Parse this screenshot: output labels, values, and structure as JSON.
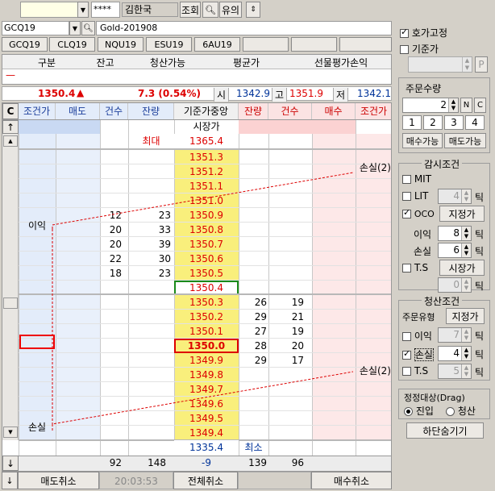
{
  "toolbar": {
    "account_input": "",
    "password_mask": "****",
    "user_name": "김한국",
    "query_button": "조회",
    "help_button": "유의",
    "updown_icon": "◆"
  },
  "symbol": {
    "code": "GCQ19",
    "name": "Gold-201908"
  },
  "tabs": [
    "GCQ19",
    "CLQ19",
    "NQU19",
    "ESU19",
    "6AU19",
    "",
    "",
    ""
  ],
  "position_table": {
    "headers": [
      "구분",
      "잔고",
      "청산가능",
      "평균가",
      "선물평가손익"
    ],
    "row_marker": "—"
  },
  "quote": {
    "price": "1350.4",
    "arrow": "▲",
    "change": "7.3 (0.54%)",
    "open_label": "시",
    "open": "1342.9",
    "high_label": "고",
    "high": "1351.9",
    "low_label": "저",
    "low": "1342.1"
  },
  "grid": {
    "c_button": "C",
    "up_button": "↑",
    "down_button": "↓",
    "headers": [
      "조건가",
      "매도",
      "건수",
      "잔량",
      "기준가중앙",
      "잔량",
      "건수",
      "매수",
      "조건가"
    ],
    "center_top": "시장가",
    "max_label": "최대",
    "max_price": "1365.4",
    "min_label": "최소",
    "min_price": "1335.4",
    "prices": [
      "1351.3",
      "1351.2",
      "1351.1",
      "1351.0",
      "1350.9",
      "1350.8",
      "1350.7",
      "1350.6",
      "1350.5",
      "1350.4",
      "1350.3",
      "1350.2",
      "1350.1",
      "1350.0",
      "1349.9",
      "1349.8",
      "1349.7",
      "1349.6",
      "1349.5",
      "1349.4"
    ],
    "ask_count": [
      "",
      "",
      "",
      "",
      "12",
      "20",
      "20",
      "22",
      "18",
      "",
      "",
      "",
      "",
      "",
      "",
      "",
      "",
      "",
      "",
      ""
    ],
    "ask_qty": [
      "",
      "",
      "",
      "",
      "23",
      "33",
      "39",
      "30",
      "23",
      "",
      "",
      "",
      "",
      "",
      "",
      "",
      "",
      "",
      "",
      ""
    ],
    "bid_qty": [
      "",
      "",
      "",
      "",
      "",
      "",
      "",
      "",
      "",
      "",
      "26",
      "29",
      "27",
      "28",
      "29",
      "",
      "",
      "",
      "",
      ""
    ],
    "bid_count": [
      "",
      "",
      "",
      "",
      "",
      "",
      "",
      "",
      "",
      "",
      "19",
      "21",
      "19",
      "20",
      "17",
      "",
      "",
      "",
      "",
      ""
    ],
    "profit_label": "이익",
    "stop_label_left": "손실",
    "stop_label_top": "손실(2)",
    "stop_label_bottom": "손실(2)",
    "totals": {
      "ask_count": "92",
      "ask_qty": "148",
      "center": "-9",
      "bid_qty": "139",
      "bid_count": "96"
    },
    "footer": {
      "sell_cancel": "매도취소",
      "time": "20:03:53",
      "all_cancel": "전체취소",
      "buy_cancel": "매수취소"
    }
  },
  "side": {
    "fix_label": "호가고정",
    "base_label": "기준가",
    "p_button": "P",
    "order_qty_title": "주문수량",
    "order_qty": "2",
    "n_button": "N",
    "c_button": "C",
    "qty_buttons": [
      "1",
      "2",
      "3",
      "4"
    ],
    "buy_avail": "매수가능",
    "sell_avail": "매도가능",
    "watch_title": "감시조건",
    "mit": "MIT",
    "lit": "LIT",
    "lit_val": "4",
    "tick": "틱",
    "oco": "OCO",
    "oco_btn": "지정가",
    "profit": "이익",
    "profit_val": "8",
    "loss": "손실",
    "loss_val": "6",
    "ts": "T.S",
    "ts_btn": "시장가",
    "ts_val": "0",
    "liq_title": "청산조건",
    "order_type": "주문유형",
    "order_type_btn": "지정가",
    "liq_profit": "이익",
    "liq_profit_val": "7",
    "liq_loss": "손실",
    "liq_loss_val": "4",
    "liq_ts": "T.S",
    "liq_ts_val": "5",
    "drag_title": "정정대상(Drag)",
    "entry": "진입",
    "exit": "청산",
    "hide_button": "하단숨기기"
  }
}
